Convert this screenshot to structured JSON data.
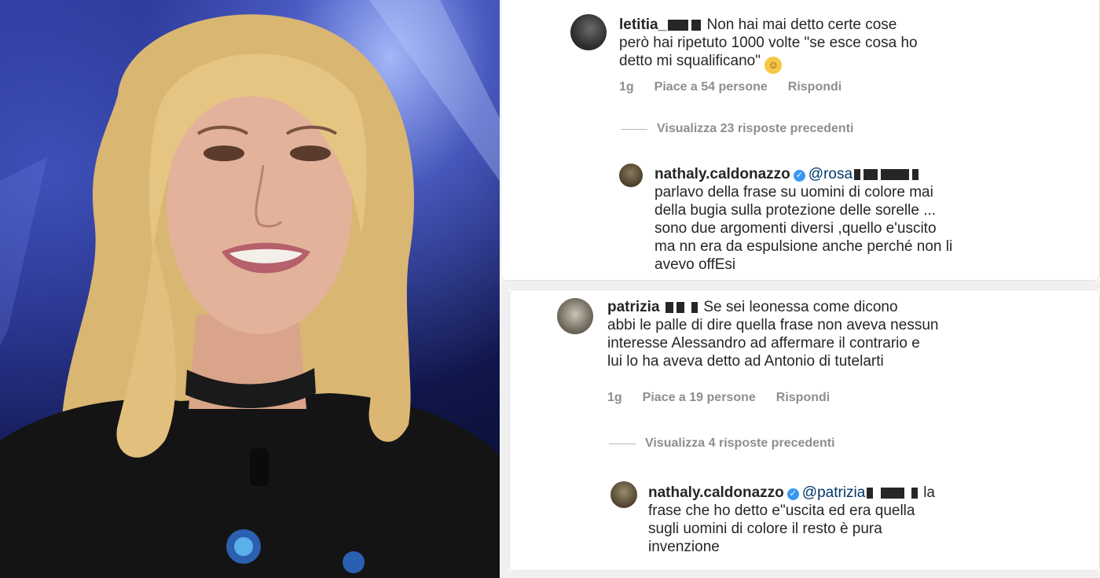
{
  "comments": [
    {
      "username": "letitia_",
      "text": "Non hai mai detto certe cose\nperò hai ripetuto 1000 volte \"se esce cosa ho\ndetto mi squalificano\"",
      "time": "1g",
      "likes": "Piace a 54 persone",
      "reply": "Rispondi",
      "view_replies": "Visualizza 23 risposte precedenti",
      "answer": {
        "username": "nathaly.caldonazzo",
        "mention": "@rosa",
        "text": "parlavo della frase su uomini di colore mai\ndella bugia sulla protezione delle sorelle ...\nsono due argomenti diversi ,quello e'uscito\nma nn era da espulsione anche perché non li\navevo offEsi"
      }
    },
    {
      "username": "patrizia",
      "text": "Se sei leonessa come dicono\nabbi le palle di dire quella frase non aveva nessun\ninteresse Alessandro ad affermare il contrario e\nlui lo ha aveva detto ad Antonio di tutelarti",
      "time": "1g",
      "likes": "Piace a 19 persone",
      "reply": "Rispondi",
      "view_replies": "Visualizza 4 risposte precedenti",
      "answer": {
        "username": "nathaly.caldonazzo",
        "mention": "@patrizia",
        "text_after": "la",
        "text": "frase che ho detto e\"uscita ed era quella\nsugli uomini di colore il resto è pura\ninvenzione"
      }
    }
  ],
  "colors": {
    "verified": "#3897f0",
    "meta": "#8e8e8e",
    "text": "#262626",
    "mention": "#00376b"
  },
  "icons": {
    "verified": "verified-badge-icon",
    "emoji": "laughing-emoji-icon"
  }
}
